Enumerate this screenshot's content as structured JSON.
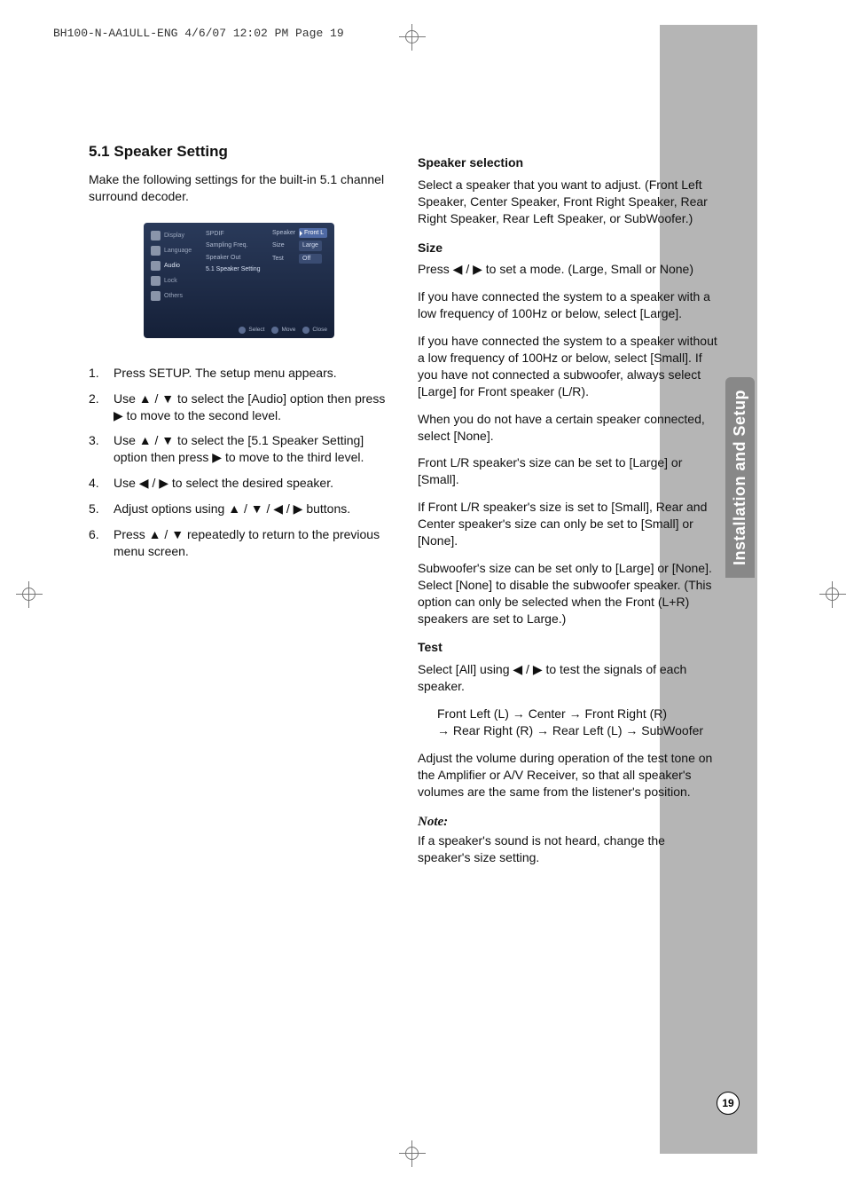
{
  "header": {
    "slug": "BH100-N-AA1ULL-ENG  4/6/07  12:02 PM  Page 19"
  },
  "sideTab": "Installation and Setup",
  "pageNumber": "19",
  "left": {
    "heading": "5.1 Speaker Setting",
    "intro": "Make the following settings for the built-in 5.1 channel surround decoder.",
    "steps": {
      "s1": "Press SETUP. The setup menu appears.",
      "s2": "Use ▲ / ▼ to select the [Audio] option then press ▶ to move to the second level.",
      "s3": "Use ▲ / ▼ to select the [5.1 Speaker Setting] option then press ▶ to move to the third level.",
      "s4": "Use ◀ / ▶ to select the desired speaker.",
      "s5": "Adjust options using ▲ / ▼ / ◀ / ▶ buttons.",
      "s6": "Press ▲ / ▼ repeatedly to return to the previous menu screen."
    }
  },
  "osd": {
    "menu": {
      "display": "Display",
      "language": "Language",
      "audio": "Audio",
      "lock": "Lock",
      "others": "Others"
    },
    "mid": {
      "spdif": "SPDIF",
      "sampling": "Sampling Freq.",
      "speakerOut": "Speaker Out",
      "setting": "5.1 Speaker Setting"
    },
    "right": {
      "speakerLabel": "Speaker",
      "speakerVal": "Front L",
      "sizeLabel": "Size",
      "sizeVal": "Large",
      "testLabel": "Test",
      "testVal": "Off"
    },
    "footer": {
      "select": "Select",
      "move": "Move",
      "close": "Close"
    }
  },
  "right": {
    "speakerSelection": {
      "heading": "Speaker selection",
      "body": "Select a speaker that you want to adjust. (Front Left Speaker, Center Speaker, Front Right Speaker, Rear Right Speaker, Rear Left Speaker, or SubWoofer.)"
    },
    "size": {
      "heading": "Size",
      "p1": "Press ◀ / ▶ to set a mode. (Large, Small or None)",
      "p2": "If you have connected the system to a speaker with a low frequency of 100Hz or below, select [Large].",
      "p3": "If you have connected the system to a speaker without a low frequency of 100Hz or below, select [Small]. If you have not connected a subwoofer, always select [Large] for Front speaker (L/R).",
      "p4": "When you do not have a certain speaker connected, select [None].",
      "p5": "Front L/R speaker's size can be set to [Large] or [Small].",
      "p6": "If Front L/R speaker's size is set to [Small], Rear and Center speaker's size can only be set to [Small] or [None].",
      "p7": "Subwoofer's size can be set only to [Large] or [None]. Select [None] to disable the subwoofer speaker. (This option can only be selected when the Front (L+R) speakers are set to Large.)"
    },
    "test": {
      "heading": "Test",
      "p1": "Select [All] using ◀ / ▶ to test the signals of each speaker.",
      "chain1": "Front Left (L) → Center → Front Right (R)",
      "chain2": "→ Rear Right (R) → Rear Left (L) → SubWoofer",
      "p2": "Adjust the volume during operation of the test tone on the Amplifier or A/V Receiver, so that all speaker's volumes are the same from the listener's position."
    },
    "note": {
      "heading": "Note:",
      "body": "If a speaker's sound is not heard, change the speaker's size setting."
    }
  }
}
